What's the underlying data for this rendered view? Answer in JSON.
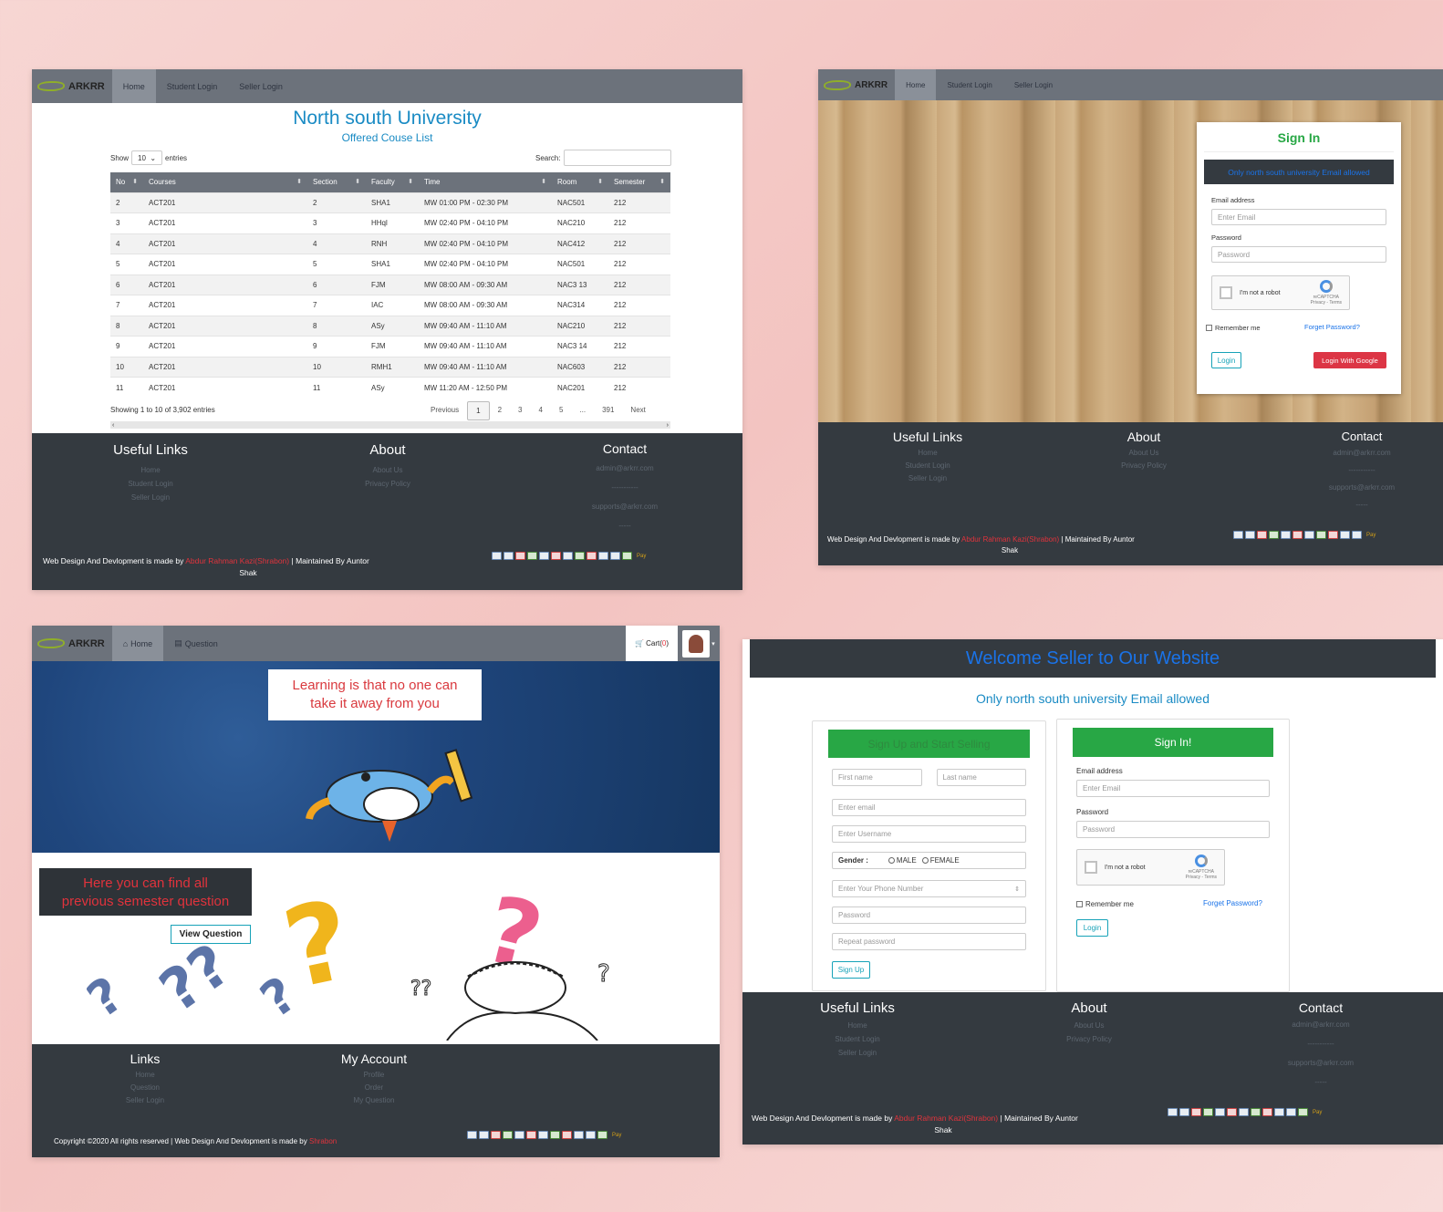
{
  "brand": "ARKRR",
  "common_nav": {
    "home": "Home",
    "student_login": "Student Login",
    "seller_login": "Seller Login"
  },
  "footer": {
    "useful_links_title": "Useful Links",
    "useful_links": [
      "Home",
      "Student Login",
      "Seller Login"
    ],
    "about_title": "About",
    "about_links": [
      "About Us",
      "Privacy Policy"
    ],
    "contact_title": "Contact",
    "contact_email": "admin@arkrr.com",
    "contact_sep": "-----------",
    "support_email": "supports@arkrr.com",
    "contact_dash": "-----",
    "credit_prefix": "Web Design And Devlopment is made by",
    "credit_name": "Abdur Rahman Kazi(Shrabon)",
    "credit_suffix": "| Maintained By Auntor",
    "credit_last": "Shak",
    "pay_label": "Pay"
  },
  "panel1": {
    "title": "North south University",
    "subtitle": "Offered Couse List",
    "show_label": "Show",
    "entries_value": "10",
    "entries_label": "entries",
    "search_label": "Search:",
    "headers": [
      "No",
      "Courses",
      "Section",
      "Faculty",
      "Time",
      "Room",
      "Semester"
    ],
    "rows": [
      [
        "2",
        "ACT201",
        "2",
        "SHA1",
        "MW 01:00 PM - 02:30 PM",
        "NAC501",
        "212"
      ],
      [
        "3",
        "ACT201",
        "3",
        "HHql",
        "MW 02:40 PM - 04:10 PM",
        "NAC210",
        "212"
      ],
      [
        "4",
        "ACT201",
        "4",
        "RNH",
        "MW 02:40 PM - 04:10 PM",
        "NAC412",
        "212"
      ],
      [
        "5",
        "ACT201",
        "5",
        "SHA1",
        "MW 02:40 PM - 04:10 PM",
        "NAC501",
        "212"
      ],
      [
        "6",
        "ACT201",
        "6",
        "FJM",
        "MW 08:00 AM - 09:30 AM",
        "NAC3 13",
        "212"
      ],
      [
        "7",
        "ACT201",
        "7",
        "IAC",
        "MW 08:00 AM - 09:30 AM",
        "NAC314",
        "212"
      ],
      [
        "8",
        "ACT201",
        "8",
        "ASy",
        "MW 09:40 AM - 11:10 AM",
        "NAC210",
        "212"
      ],
      [
        "9",
        "ACT201",
        "9",
        "FJM",
        "MW 09:40 AM - 11:10 AM",
        "NAC3 14",
        "212"
      ],
      [
        "10",
        "ACT201",
        "10",
        "RMH1",
        "MW 09:40 AM - 11:10 AM",
        "NAC603",
        "212"
      ],
      [
        "11",
        "ACT201",
        "11",
        "ASy",
        "MW 11:20 AM - 12:50 PM",
        "NAC201",
        "212"
      ]
    ],
    "showing": "Showing 1 to 10 of 3,902 entries",
    "pager": [
      "Previous",
      "1",
      "2",
      "3",
      "4",
      "5",
      "...",
      "391",
      "Next"
    ]
  },
  "panel2": {
    "sign_in_title": "Sign In",
    "notice": "Only north south university Email allowed",
    "email_label": "Email address",
    "email_placeholder": "Enter Email",
    "password_label": "Password",
    "password_placeholder": "Password",
    "captcha_text": "I'm not a robot",
    "captcha_brand": "reCAPTCHA",
    "captcha_terms": "Privacy - Terms",
    "remember": "Remember me",
    "forget": "Forget Password?",
    "login": "Login",
    "google": "Login With Google"
  },
  "panel3": {
    "nav_home": "Home",
    "nav_question": "Question",
    "cart": "Cart(",
    "cart_count": "0",
    "cart_close": ")",
    "quote_line1": "Learning is that no one can",
    "quote_line2": "take it away from you",
    "find_line1": "Here you can find all",
    "find_line2": "previous semester question",
    "view_question": "View Question",
    "links_title": "Links",
    "links": [
      "Home",
      "Question",
      "Seller Login"
    ],
    "account_title": "My Account",
    "account_links": [
      "Profile",
      "Order",
      "My Question"
    ],
    "copyright": "Copyright ©2020 All rights reserved | Web Design And Devlopment is made by",
    "copyright_name": "Shrabon"
  },
  "panel4": {
    "welcome": "Welcome Seller to Our Website",
    "notice": "Only north south university Email allowed",
    "signup_header": "Sign Up and Start Selling",
    "first_name": "First name",
    "last_name": "Last name",
    "email": "Enter email",
    "username": "Enter Username",
    "gender_label": "Gender :",
    "male": "MALE",
    "female": "FEMALE",
    "phone": "Enter Your Phone Number",
    "password": "Password",
    "repeat_password": "Repeat password",
    "signup_btn": "Sign Up",
    "signin_header": "Sign In!",
    "email_label": "Email address",
    "email_placeholder": "Enter Email",
    "password_label": "Password",
    "password_placeholder": "Password",
    "captcha_text": "I'm not a robot",
    "captcha_brand": "reCAPTCHA",
    "captcha_terms": "Privacy - Terms",
    "remember": "Remember me",
    "forget": "Forget Password?",
    "login": "Login"
  },
  "colors": {
    "accent_blue": "#1a8bc4",
    "green": "#28a745",
    "danger": "#dc3545",
    "footer_dark": "#343a40",
    "nav_gray": "#6c727b"
  }
}
